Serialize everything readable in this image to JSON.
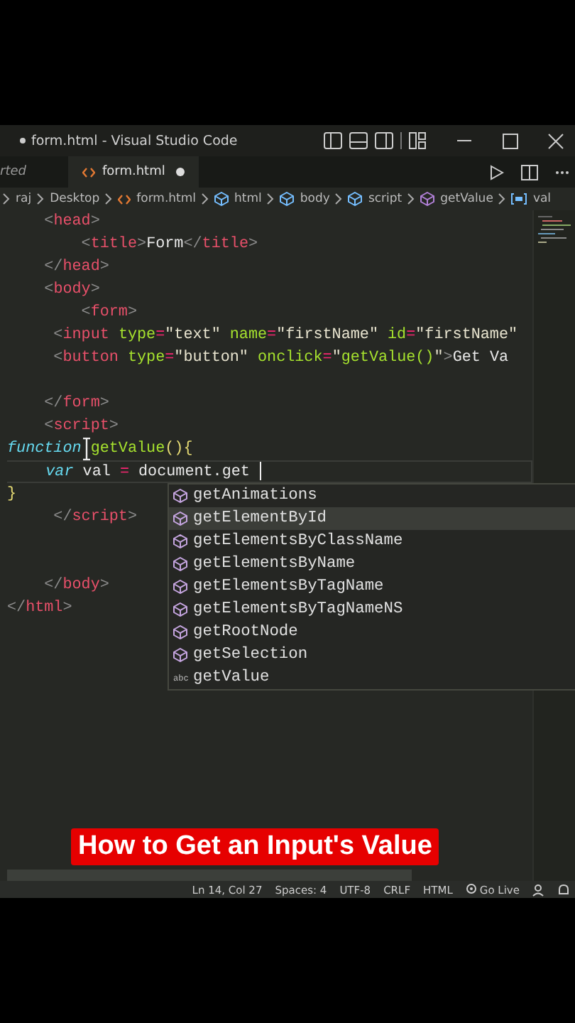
{
  "window": {
    "title": "form.html - Visual Studio Code",
    "dirty": true
  },
  "tabs": [
    {
      "label": "rted",
      "selected": false,
      "dirty": false
    },
    {
      "label": "form.html",
      "selected": true,
      "dirty": true
    }
  ],
  "breadcrumbs": [
    {
      "label": "raj",
      "kind": "folder"
    },
    {
      "label": "Desktop",
      "kind": "folder"
    },
    {
      "label": "form.html",
      "kind": "file"
    },
    {
      "label": "html",
      "kind": "element"
    },
    {
      "label": "body",
      "kind": "element"
    },
    {
      "label": "script",
      "kind": "element"
    },
    {
      "label": "getValue",
      "kind": "method"
    },
    {
      "label": "val",
      "kind": "variable"
    }
  ],
  "code_lines": [
    {
      "current": false,
      "tokens": [
        {
          "kind": "punct",
          "text": "    <"
        },
        {
          "kind": "tag",
          "text": "head"
        },
        {
          "kind": "punct",
          "text": ">"
        }
      ]
    },
    {
      "current": false,
      "tokens": [
        {
          "kind": "punct",
          "text": "        <"
        },
        {
          "kind": "tag",
          "text": "title"
        },
        {
          "kind": "punct",
          "text": ">"
        },
        {
          "kind": "plain",
          "text": "Form"
        },
        {
          "kind": "punct",
          "text": "</"
        },
        {
          "kind": "tag",
          "text": "title"
        },
        {
          "kind": "punct",
          "text": ">"
        }
      ]
    },
    {
      "current": false,
      "tokens": [
        {
          "kind": "punct",
          "text": "    </"
        },
        {
          "kind": "tag",
          "text": "head"
        },
        {
          "kind": "punct",
          "text": ">"
        }
      ]
    },
    {
      "current": false,
      "tokens": [
        {
          "kind": "punct",
          "text": "    <"
        },
        {
          "kind": "tag",
          "text": "body"
        },
        {
          "kind": "punct",
          "text": ">"
        }
      ]
    },
    {
      "current": false,
      "tokens": [
        {
          "kind": "punct",
          "text": "        <"
        },
        {
          "kind": "tag",
          "text": "form"
        },
        {
          "kind": "punct",
          "text": ">"
        }
      ]
    },
    {
      "current": false,
      "tokens": [
        {
          "kind": "punct",
          "text": "     <"
        },
        {
          "kind": "tag",
          "text": "input"
        },
        {
          "kind": "attr",
          "text": " type"
        },
        {
          "kind": "op",
          "text": "="
        },
        {
          "kind": "string",
          "text": "\"text\""
        },
        {
          "kind": "attr",
          "text": " name"
        },
        {
          "kind": "op",
          "text": "="
        },
        {
          "kind": "string",
          "text": "\"firstName\""
        },
        {
          "kind": "attr",
          "text": " id"
        },
        {
          "kind": "op",
          "text": "="
        },
        {
          "kind": "string",
          "text": "\"firstName\""
        }
      ]
    },
    {
      "current": false,
      "tokens": [
        {
          "kind": "punct",
          "text": "     <"
        },
        {
          "kind": "tag",
          "text": "button"
        },
        {
          "kind": "attr",
          "text": " type"
        },
        {
          "kind": "op",
          "text": "="
        },
        {
          "kind": "string",
          "text": "\"button\""
        },
        {
          "kind": "attr",
          "text": " onclick"
        },
        {
          "kind": "op",
          "text": "="
        },
        {
          "kind": "string",
          "text": "\""
        },
        {
          "kind": "fn",
          "text": "getValue()"
        },
        {
          "kind": "string",
          "text": "\""
        },
        {
          "kind": "punct",
          "text": ">"
        },
        {
          "kind": "plain",
          "text": "Get Va"
        }
      ]
    },
    {
      "current": false
    },
    {
      "current": false,
      "tokens": [
        {
          "kind": "punct",
          "text": "    </"
        },
        {
          "kind": "tag",
          "text": "form"
        },
        {
          "kind": "punct",
          "text": ">"
        }
      ]
    },
    {
      "current": false,
      "tokens": [
        {
          "kind": "punct",
          "text": "    <"
        },
        {
          "kind": "tag",
          "text": "script"
        },
        {
          "kind": "punct",
          "text": ">"
        }
      ]
    },
    {
      "current": false,
      "tokens": [
        {
          "kind": "keyword",
          "text": "function"
        },
        {
          "kind": "fn",
          "text": "getValue"
        },
        {
          "kind": "brace",
          "text": "(){"
        }
      ]
    },
    {
      "current": true,
      "tokens": [
        {
          "kind": "keyword",
          "text": "    var"
        },
        {
          "kind": "plain",
          "text": " val "
        },
        {
          "kind": "op",
          "text": "="
        },
        {
          "kind": "plain",
          "text": " document.get"
        }
      ]
    },
    {
      "current": false,
      "tokens": [
        {
          "kind": "brace",
          "text": "}"
        }
      ]
    },
    {
      "current": false,
      "tokens": [
        {
          "kind": "punct",
          "text": "     </"
        },
        {
          "kind": "tag",
          "text": "script"
        },
        {
          "kind": "punct",
          "text": ">"
        }
      ]
    },
    {
      "current": false
    },
    {
      "current": false
    },
    {
      "current": false,
      "tokens": [
        {
          "kind": "punct",
          "text": "    </"
        },
        {
          "kind": "tag",
          "text": "body"
        },
        {
          "kind": "punct",
          "text": ">"
        }
      ]
    },
    {
      "current": false,
      "tokens": [
        {
          "kind": "punct",
          "text": "</"
        },
        {
          "kind": "tag",
          "text": "html"
        },
        {
          "kind": "punct",
          "text": ">"
        }
      ]
    }
  ],
  "suggestions": [
    {
      "label": "getAnimations",
      "kind": "method",
      "selected": false
    },
    {
      "label": "getElementById",
      "kind": "method",
      "selected": true
    },
    {
      "label": "getElementsByClassName",
      "kind": "method",
      "selected": false
    },
    {
      "label": "getElementsByName",
      "kind": "method",
      "selected": false
    },
    {
      "label": "getElementsByTagName",
      "kind": "method",
      "selected": false
    },
    {
      "label": "getElementsByTagNameNS",
      "kind": "method",
      "selected": false
    },
    {
      "label": "getRootNode",
      "kind": "method",
      "selected": false
    },
    {
      "label": "getSelection",
      "kind": "method",
      "selected": false
    },
    {
      "label": "getValue",
      "kind": "word",
      "badge": "abc",
      "selected": false
    }
  ],
  "caption": "How to Get an Input's Value",
  "status_bar": [
    "Ln 14, Col 27",
    "Spaces: 4",
    "UTF-8",
    "CRLF",
    "HTML",
    "Go Live"
  ]
}
